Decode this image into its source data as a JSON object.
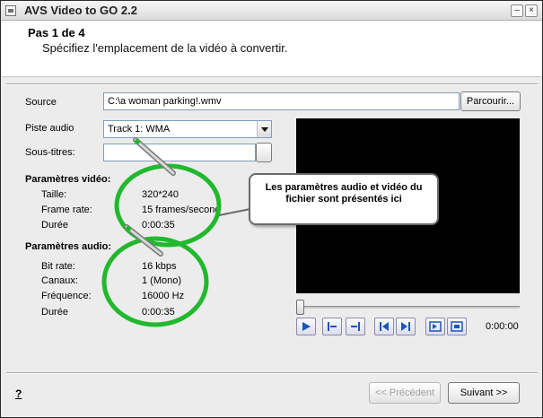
{
  "window": {
    "title": "AVS Video to GO 2.2",
    "minimize_glyph": "–",
    "close_glyph": "×"
  },
  "header": {
    "step": "Pas 1 de 4",
    "description": "Spécifiez l'emplacement de la vidéo à convertir."
  },
  "source": {
    "label": "Source",
    "value": "C:\\a woman parking!.wmv",
    "browse_label": "Parcourir..."
  },
  "audio_track": {
    "label": "Piste audio",
    "value": "Track 1: WMA"
  },
  "subtitles": {
    "label": "Sous-titres:",
    "value": ""
  },
  "video_params": {
    "heading": "Paramètres vidéo:",
    "rows": [
      {
        "label": "Taille:",
        "value": "320*240"
      },
      {
        "label": "Frame rate:",
        "value": "15 frames/second"
      },
      {
        "label": "Durée",
        "value": "0:00:35"
      }
    ]
  },
  "audio_params": {
    "heading": "Paramètres audio:",
    "rows": [
      {
        "label": "Bit rate:",
        "value": "16 kbps"
      },
      {
        "label": "Canaux:",
        "value": "1 (Mono)"
      },
      {
        "label": "Fréquence:",
        "value": "16000 Hz"
      },
      {
        "label": "Durée",
        "value": "0:00:35"
      }
    ]
  },
  "player": {
    "time": "0:00:00",
    "position": 0,
    "buttons": [
      "play-icon",
      "mark-in-icon",
      "mark-out-icon",
      "skip-start-icon",
      "skip-end-icon",
      "next-frame-icon",
      "fit-icon"
    ]
  },
  "callout": {
    "text": "Les paramètres audio et vidéo du fichier sont présentés ici"
  },
  "footer": {
    "help": "?",
    "previous_label": "<< Précédent",
    "next_label": "Suivant >>"
  },
  "colors": {
    "highlight_green": "#22b82e",
    "preview_bg": "#000000"
  }
}
